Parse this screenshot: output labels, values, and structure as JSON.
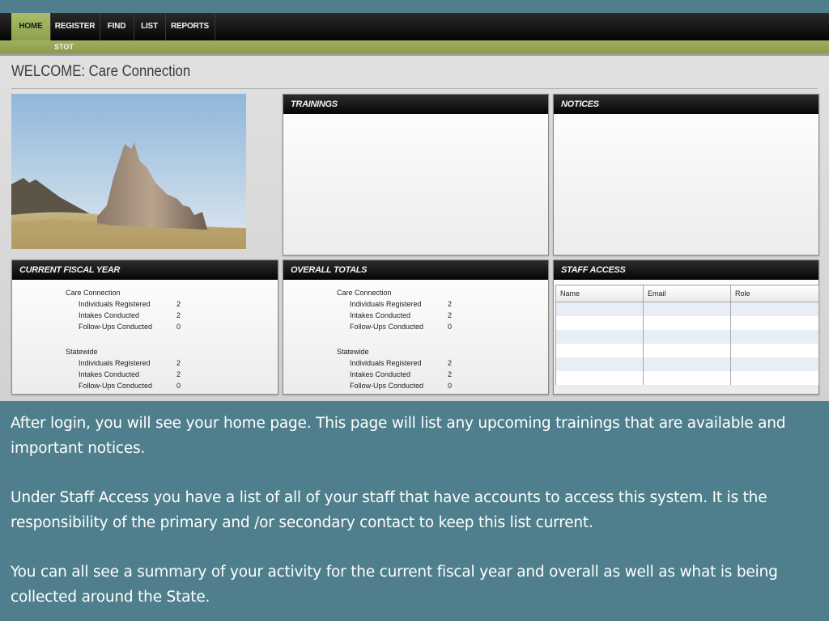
{
  "nav": {
    "items": [
      {
        "label": "HOME"
      },
      {
        "label": "REGISTER"
      },
      {
        "label": "FIND"
      },
      {
        "label": "LIST"
      },
      {
        "label": "REPORTS"
      }
    ],
    "sub_item": "STOT"
  },
  "page_title": "WELCOME: Care Connection",
  "hero_image": "landscape-photo-rock-formation",
  "panels": {
    "trainings": {
      "title": "TRAININGS"
    },
    "notices": {
      "title": "NOTICES"
    },
    "current_fiscal_year": {
      "title": "CURRENT FISCAL YEAR",
      "groups": [
        {
          "label": "Care Connection",
          "rows": [
            {
              "label": "Individuals Registered",
              "value": "2"
            },
            {
              "label": "Intakes Conducted",
              "value": "2"
            },
            {
              "label": "Follow-Ups Conducted",
              "value": "0"
            }
          ]
        },
        {
          "label": "Statewide",
          "rows": [
            {
              "label": "Individuals Registered",
              "value": "2"
            },
            {
              "label": "Intakes Conducted",
              "value": "2"
            },
            {
              "label": "Follow-Ups Conducted",
              "value": "0"
            }
          ]
        }
      ]
    },
    "overall_totals": {
      "title": "OVERALL TOTALS",
      "groups": [
        {
          "label": "Care Connection",
          "rows": [
            {
              "label": "Individuals Registered",
              "value": "2"
            },
            {
              "label": "Intakes Conducted",
              "value": "2"
            },
            {
              "label": "Follow-Ups Conducted",
              "value": "0"
            }
          ]
        },
        {
          "label": "Statewide",
          "rows": [
            {
              "label": "Individuals Registered",
              "value": "2"
            },
            {
              "label": "Intakes Conducted",
              "value": "2"
            },
            {
              "label": "Follow-Ups Conducted",
              "value": "0"
            }
          ]
        }
      ]
    },
    "staff_access": {
      "title": "STAFF ACCESS",
      "columns": [
        "Name",
        "Email",
        "Role"
      ]
    }
  },
  "caption": {
    "p1": "After login, you will see your home page. This page will list any upcoming trainings that are available and important notices.",
    "p2": "Under Staff Access you have a list of all of your staff that have accounts to access this system. It is the responsibility of the primary and /or secondary contact to keep this list current.",
    "p3": "You can all see a summary of your activity for the current fiscal year and overall as well as what is being collected around the State."
  },
  "colors": {
    "slide_background": "#4f7f8c",
    "nav_active": "#9db35a",
    "panel_header": "#0a0a0a"
  }
}
